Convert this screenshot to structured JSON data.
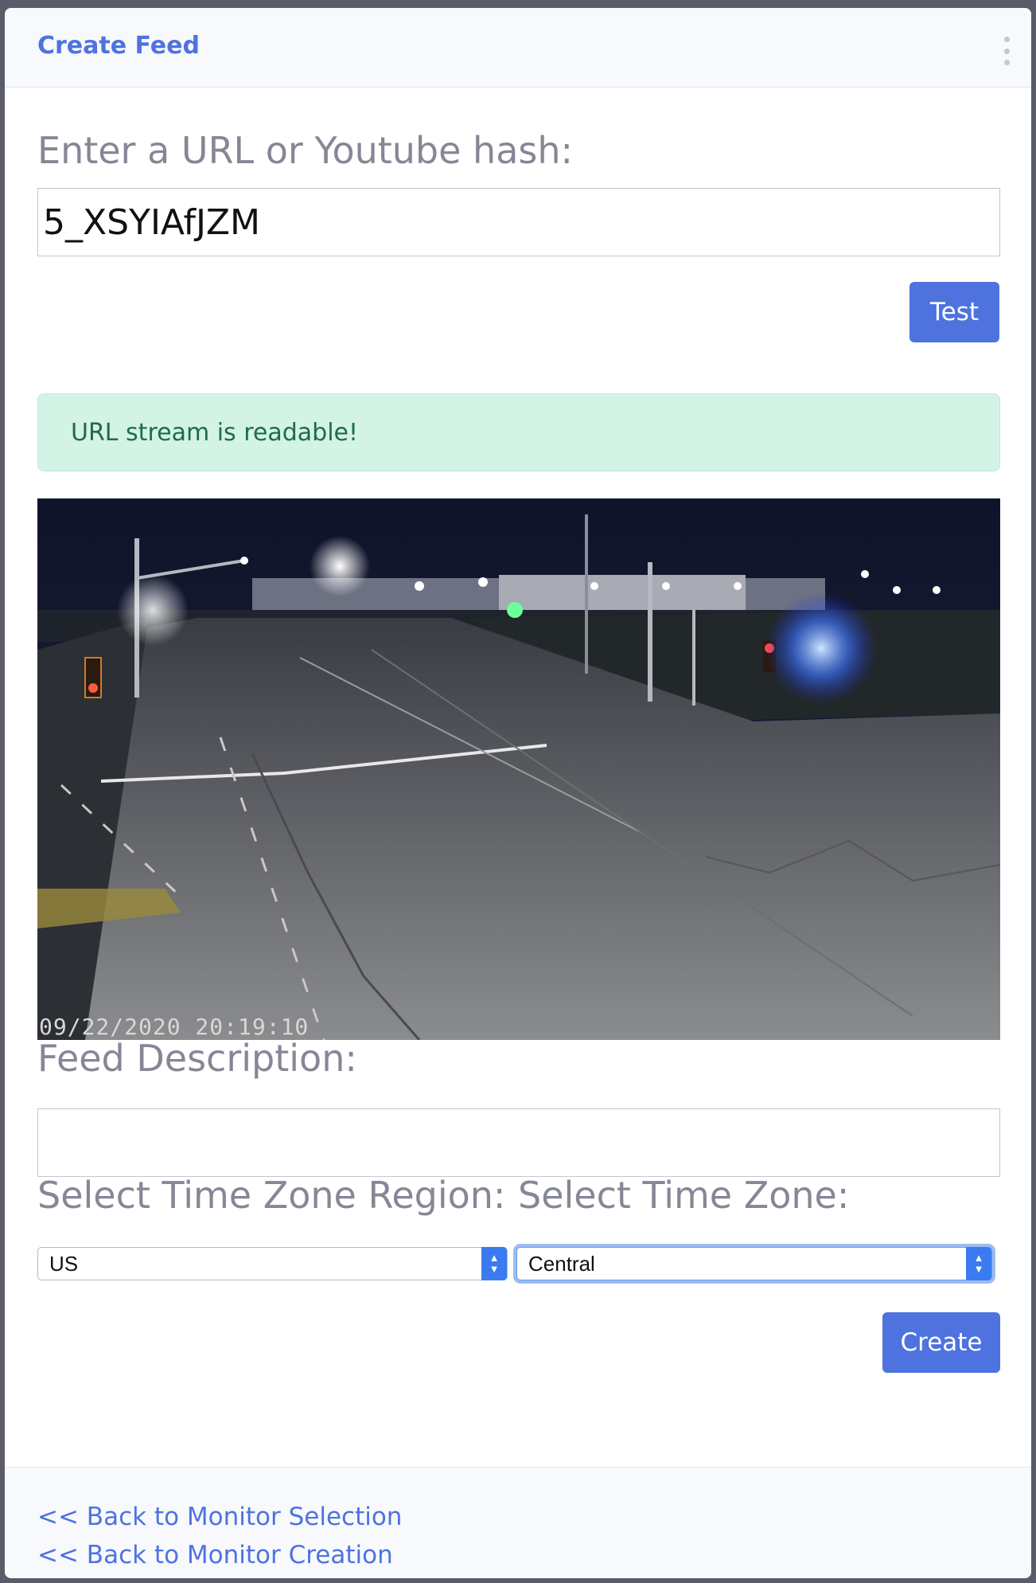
{
  "header": {
    "title": "Create Feed",
    "menu_icon": "vertical-ellipsis-icon"
  },
  "url_section": {
    "label": "Enter a URL or Youtube hash:",
    "value": "5_XSYIAfJZM",
    "test_label": "Test"
  },
  "alert": {
    "text": "URL stream is readable!",
    "color": "#d3f3e6"
  },
  "video": {
    "timestamp": "09/22/2020 20:19:10"
  },
  "description": {
    "label": "Feed Description:",
    "value": ""
  },
  "timezone": {
    "region_label": "Select Time Zone Region:",
    "region_value": "US",
    "zone_label": "Select Time Zone:",
    "zone_value": "Central"
  },
  "create_label": "Create",
  "footer": {
    "links": [
      "<< Back to Monitor Selection",
      "<< Back to Monitor Creation"
    ]
  },
  "colors": {
    "primary": "#4e73df",
    "label_gray": "#858796",
    "success_bg": "#d3f3e6"
  }
}
